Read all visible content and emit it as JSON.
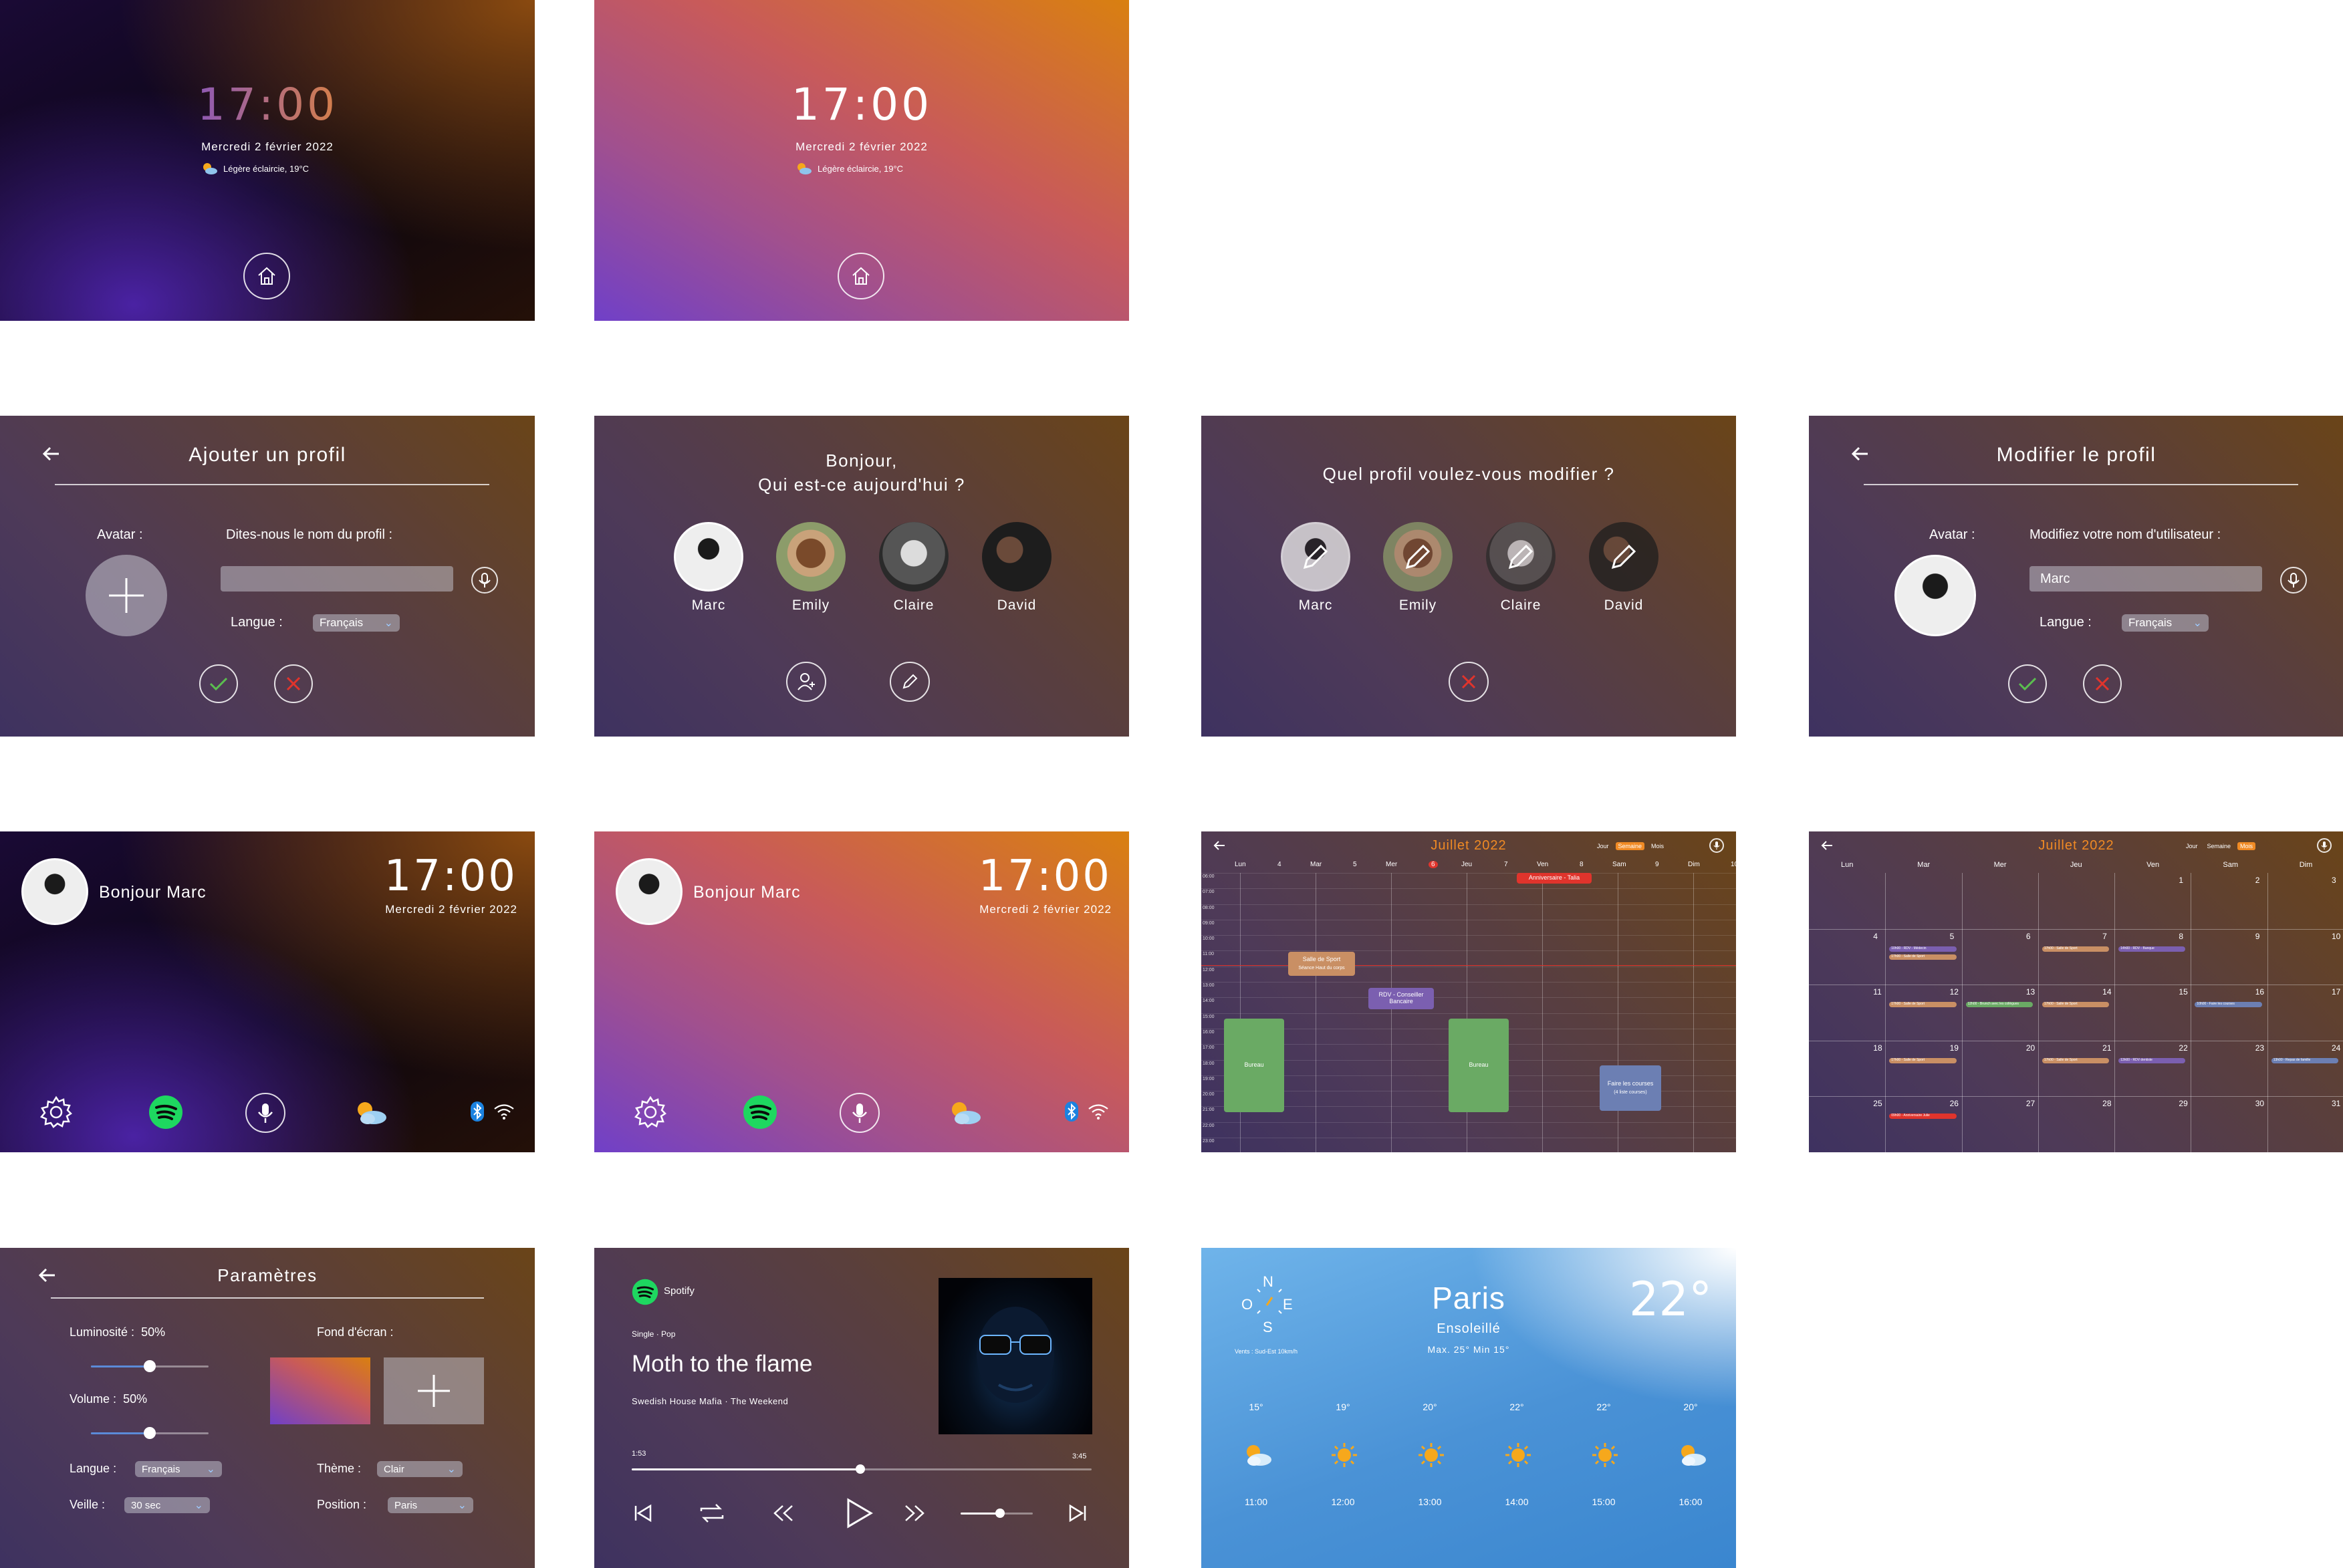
{
  "lockscreen": {
    "time": "17:00",
    "date": "Mercredi 2 février 2022",
    "weather": "Légère éclaircie, 19°C",
    "home_icon": "home-icon"
  },
  "add_profile": {
    "title": "Ajouter un profil",
    "avatar_label": "Avatar :",
    "name_label": "Dites-nous le nom du profil :",
    "lang_label": "Langue :",
    "lang_value": "Français"
  },
  "select_profile": {
    "greeting_line1": "Bonjour,",
    "greeting_line2": "Qui est-ce aujourd'hui ?",
    "profiles": [
      "Marc",
      "Emily",
      "Claire",
      "David"
    ]
  },
  "edit_select": {
    "title": "Quel profil voulez-vous modifier ?",
    "profiles": [
      "Marc",
      "Emily",
      "Claire",
      "David"
    ]
  },
  "edit_profile": {
    "title": "Modifier le profil",
    "avatar_label": "Avatar :",
    "name_label": "Modifiez votre nom d'utilisateur :",
    "name_value": "Marc",
    "lang_label": "Langue :",
    "lang_value": "Français"
  },
  "home": {
    "greeting": "Bonjour Marc",
    "time": "17:00",
    "date": "Mercredi 2 février 2022"
  },
  "calendar_week": {
    "title": "Juillet 2022",
    "views": [
      "Jour",
      "Semaine",
      "Mois"
    ],
    "active_view": "Semaine",
    "days": [
      {
        "name": "Lun",
        "num": "4"
      },
      {
        "name": "Mar",
        "num": "5"
      },
      {
        "name": "Mer",
        "num": "6"
      },
      {
        "name": "Jeu",
        "num": "7"
      },
      {
        "name": "Ven",
        "num": "8"
      },
      {
        "name": "Sam",
        "num": "9"
      },
      {
        "name": "Dim",
        "num": "10"
      }
    ],
    "hours": [
      "06:00",
      "07:00",
      "08:00",
      "09:00",
      "10:00",
      "11:00",
      "12:00",
      "13:00",
      "14:00",
      "15:00",
      "16:00",
      "17:00",
      "18:00",
      "19:00",
      "20:00",
      "21:00",
      "22:00",
      "23:00"
    ],
    "events": {
      "sport_title": "Salle de Sport",
      "sport_sub": "Séance Haut du corps",
      "bureau1": "Bureau",
      "rdv": "RDV - Conseiller Bancaire",
      "bureau2": "Bureau",
      "anniv": "Anniversaire - Talia",
      "courses_title": "Faire les courses",
      "courses_sub": "(4 liste courses)"
    }
  },
  "calendar_month": {
    "title": "Juillet 2022",
    "views": [
      "Jour",
      "Semaine",
      "Mois"
    ],
    "active_view": "Mois",
    "weekdays": [
      "Lun",
      "Mar",
      "Mer",
      "Jeu",
      "Ven",
      "Sam",
      "Dim"
    ],
    "weeks": [
      [
        "",
        "",
        "",
        "",
        "1",
        "2",
        "3"
      ],
      [
        "4",
        "5",
        "6",
        "7",
        "8",
        "9",
        "10"
      ],
      [
        "11",
        "12",
        "13",
        "14",
        "15",
        "16",
        "17"
      ],
      [
        "18",
        "19",
        "20",
        "21",
        "22",
        "23",
        "24"
      ],
      [
        "25",
        "26",
        "27",
        "28",
        "29",
        "30",
        "31"
      ]
    ],
    "events": {
      "e1": "10h00 - RDV - Médecin",
      "e2": "17h00 - Salle de Sport",
      "e3": "17h00 - Salle de Sport",
      "e4": "14h00 - RDV - Banque",
      "e5": "17h00 - Salle de Sport",
      "e6": "12h00 - Brunch avec les collègues",
      "e7": "17h00 - Salle de Sport",
      "e8": "10h00 - Faire les courses",
      "e9": "17h00 - Salle de Sport",
      "e10": "17h00 - Salle de Sport",
      "e11": "13h00 - RDV dentiste",
      "e12": "13h00 - Repas de famille",
      "e13": "09h00 - Anniversaire Julie"
    }
  },
  "settings": {
    "title": "Paramètres",
    "brightness_label": "Luminosité :",
    "brightness_value": "50%",
    "brightness_level": 0.5,
    "volume_label": "Volume :",
    "volume_value": "50%",
    "volume_level": 0.5,
    "lang_label": "Langue :",
    "lang_value": "Français",
    "sleep_label": "Veille :",
    "sleep_value": "30 sec",
    "wallpaper_label": "Fond d'écran :",
    "theme_label": "Thème :",
    "theme_value": "Clair",
    "position_label": "Position :",
    "position_value": "Paris"
  },
  "spotify": {
    "app": "Spotify",
    "meta": "Single · Pop",
    "title": "Moth to the flame",
    "artist": "Swedish House Mafia · The Weekend",
    "elapsed": "1:53",
    "total": "3:45",
    "progress": 0.5
  },
  "weather": {
    "compass": {
      "n": "N",
      "o": "O",
      "e": "E",
      "s": "S"
    },
    "wind": "Vents : Sud-Est 10km/h",
    "city": "Paris",
    "condition": "Ensoleillé",
    "minmax": "Max. 25° Min 15°",
    "temp": "22°",
    "hourly": [
      {
        "temp": "15°",
        "time": "11:00",
        "icon": "cloud-sun-icon"
      },
      {
        "temp": "19°",
        "time": "12:00",
        "icon": "sun-icon"
      },
      {
        "temp": "20°",
        "time": "13:00",
        "icon": "sun-icon"
      },
      {
        "temp": "22°",
        "time": "14:00",
        "icon": "sun-icon"
      },
      {
        "temp": "22°",
        "time": "15:00",
        "icon": "sun-icon"
      },
      {
        "temp": "20°",
        "time": "16:00",
        "icon": "cloud-sun-icon"
      }
    ]
  },
  "colors": {
    "spotify_green": "#1ed760",
    "accent_orange": "#f08a24",
    "confirm_green": "#5bbf4f",
    "cancel_red": "#e0342c"
  }
}
